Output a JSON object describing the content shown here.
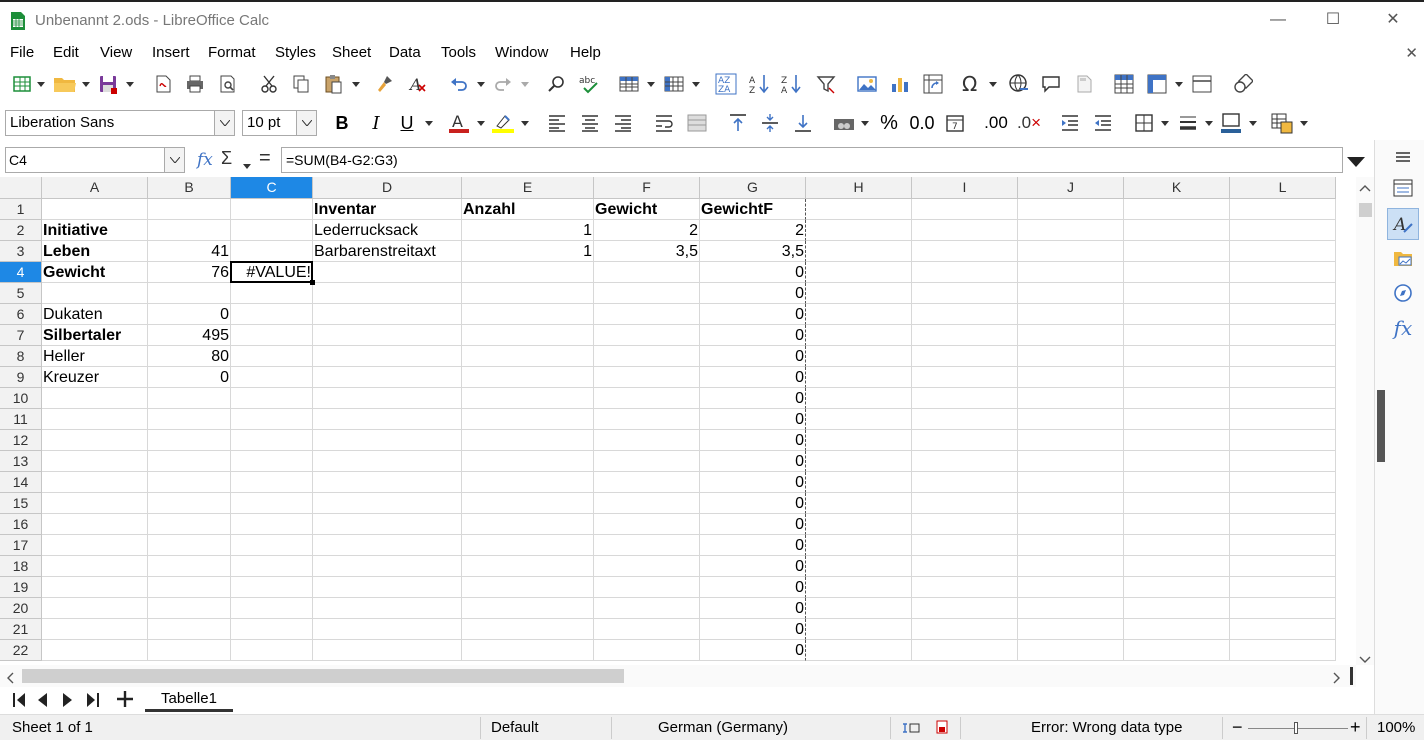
{
  "window": {
    "title": "Unbenannt 2.ods - LibreOffice Calc"
  },
  "menu": [
    "File",
    "Edit",
    "View",
    "Insert",
    "Format",
    "Styles",
    "Sheet",
    "Data",
    "Tools",
    "Window",
    "Help"
  ],
  "font": {
    "name": "Liberation Sans",
    "size": "10 pt"
  },
  "formula_bar": {
    "cell_ref": "C4",
    "formula": "=SUM(B4-G2:G3)",
    "fx_label": "fx",
    "sigma": "Σ",
    "equals": "="
  },
  "columns": [
    "A",
    "B",
    "C",
    "D",
    "E",
    "F",
    "G",
    "H",
    "I",
    "J",
    "K",
    "L"
  ],
  "selected_column": "C",
  "selected_row": "4",
  "rows": [
    "1",
    "2",
    "3",
    "4",
    "5",
    "6",
    "7",
    "8",
    "9",
    "10",
    "11",
    "12",
    "13",
    "14",
    "15",
    "16",
    "17",
    "18",
    "19",
    "20",
    "21",
    "22"
  ],
  "cells": {
    "D1": "Inventar",
    "E1": "Anzahl",
    "F1": "Gewicht",
    "G1": "GewichtF",
    "A2": "Initiative",
    "D2": "Lederrucksack",
    "E2": "1",
    "F2": "2",
    "G2": "2",
    "A3": "Leben",
    "B3": "41",
    "D3": "Barbarenstreitaxt",
    "E3": "1",
    "F3": "3,5",
    "G3": "3,5",
    "A4": "Gewicht",
    "B4": "76",
    "C4": "#VALUE!",
    "G4": "0",
    "G5": "0",
    "A6": "Dukaten",
    "B6": "0",
    "G6": "0",
    "A7": "Silbertaler",
    "B7": "495",
    "G7": "0",
    "A8": "Heller",
    "B8": "80",
    "G8": "0",
    "A9": "Kreuzer",
    "B9": "0",
    "G9": "0",
    "G10": "0",
    "G11": "0",
    "G12": "0",
    "G13": "0",
    "G14": "0",
    "G15": "0",
    "G16": "0",
    "G17": "0",
    "G18": "0",
    "G19": "0",
    "G20": "0",
    "G21": "0",
    "G22": "0"
  },
  "sheet_tab": {
    "label": "Tabelle1"
  },
  "status": {
    "sheet": "Sheet 1 of 1",
    "style": "Default",
    "language": "German (Germany)",
    "message": "Error: Wrong data type",
    "zoom": "100%",
    "zoom_minus": "−",
    "zoom_plus": "+"
  },
  "colors": {
    "selection": "#1e88e5",
    "app_green": "#1d8f3a"
  },
  "icons": [
    "new-icon",
    "open-icon",
    "save-icon",
    "export-pdf-icon",
    "print-icon",
    "print-preview-icon",
    "cut-icon",
    "copy-icon",
    "paste-icon",
    "clone-formatting-icon",
    "clear-formatting-icon",
    "undo-icon",
    "redo-icon",
    "find-replace-icon",
    "spelling-icon",
    "row-icon",
    "column-icon",
    "sort-icon",
    "sort-ascending-icon",
    "sort-descending-icon",
    "autofilter-icon",
    "image-icon",
    "chart-icon",
    "pivot-table-icon",
    "special-character-icon",
    "hyperlink-icon",
    "comment-icon",
    "header-footer-icon",
    "define-print-area-icon",
    "freeze-icon",
    "split-window-icon",
    "show-draw-functions-icon"
  ]
}
